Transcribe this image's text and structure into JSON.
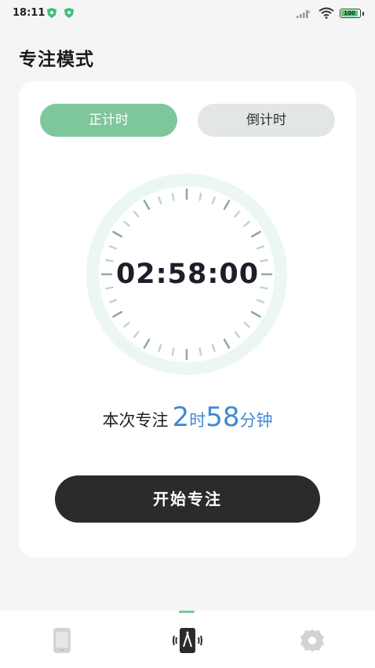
{
  "status_bar": {
    "time": "18:11",
    "battery": "100"
  },
  "page": {
    "title": "专注模式"
  },
  "mode_tabs": {
    "count_up": "正计时",
    "count_down": "倒计时",
    "selected": "count_up"
  },
  "timer": {
    "display": "02:58:00"
  },
  "summary": {
    "label": "本次专注",
    "hours": "2",
    "hours_unit": "时",
    "minutes": "58",
    "minutes_unit": "分钟"
  },
  "start_button": {
    "label": "开始专注"
  },
  "bottom_nav": {
    "items": [
      "phone-icon",
      "focus-icon",
      "settings-icon"
    ],
    "active": 1
  },
  "colors": {
    "accent_green": "#7ec79b",
    "accent_blue": "#3f8ad6",
    "button_dark": "#2b2b2b"
  }
}
